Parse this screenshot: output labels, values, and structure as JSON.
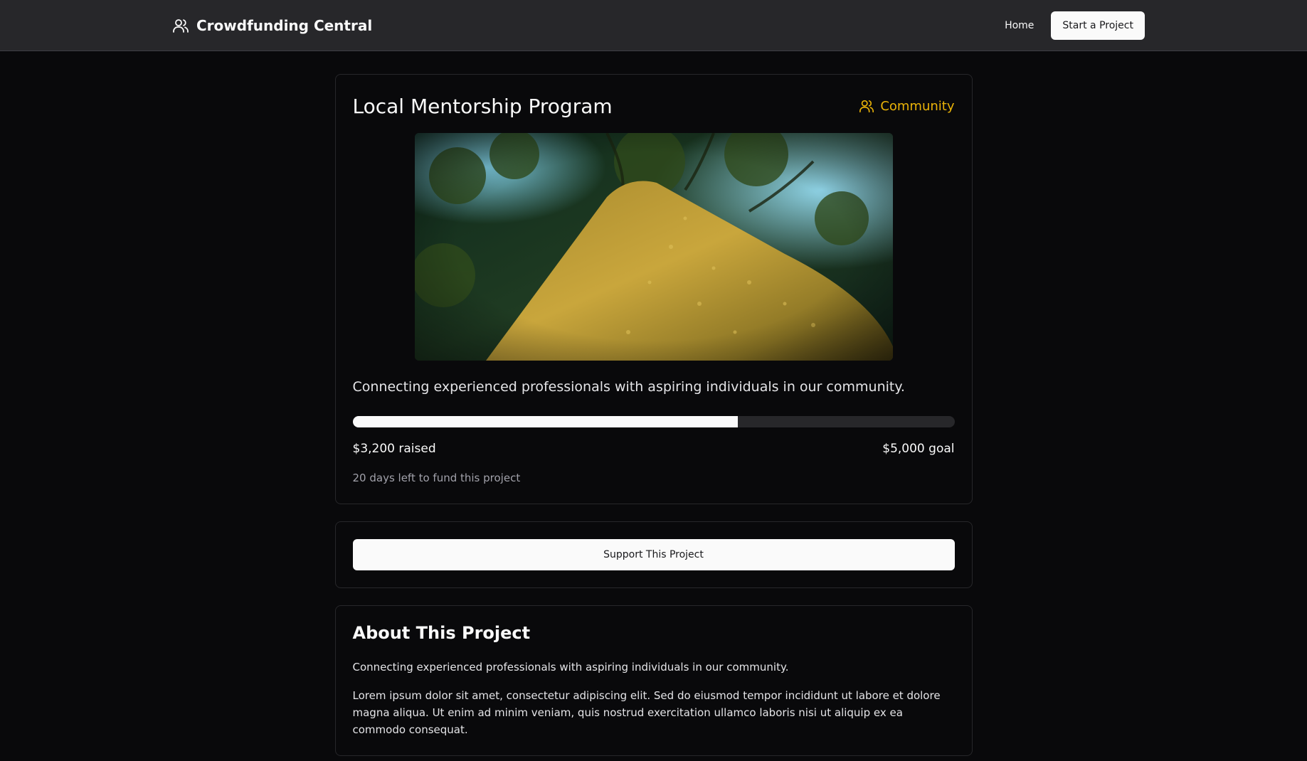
{
  "nav": {
    "brand": "Crowdfunding Central",
    "brand_icon": "users-icon",
    "home_label": "Home",
    "cta_label": "Start a Project"
  },
  "project": {
    "title": "Local Mentorship Program",
    "category": "Community",
    "category_icon": "users-icon",
    "category_color": "#eab308",
    "image_alt": "Moss-covered tree trunk viewed from below",
    "tagline": "Connecting experienced professionals with aspiring individuals in our community.",
    "raised_label": "$3,200 raised",
    "goal_label": "$5,000 goal",
    "raised": 3200,
    "goal": 5000,
    "progress_fraction": 0.64,
    "days_left_label": "20 days left to fund this project"
  },
  "support": {
    "button_label": "Support This Project"
  },
  "about": {
    "title": "About This Project",
    "paragraphs": [
      "Connecting experienced professionals with aspiring individuals in our community.",
      "Lorem ipsum dolor sit amet, consectetur adipiscing elit. Sed do eiusmod tempor incididunt ut labore et dolore magna aliqua. Ut enim ad minim veniam, quis nostrud exercitation ullamco laboris nisi ut aliquip ex ea commodo consequat."
    ]
  }
}
